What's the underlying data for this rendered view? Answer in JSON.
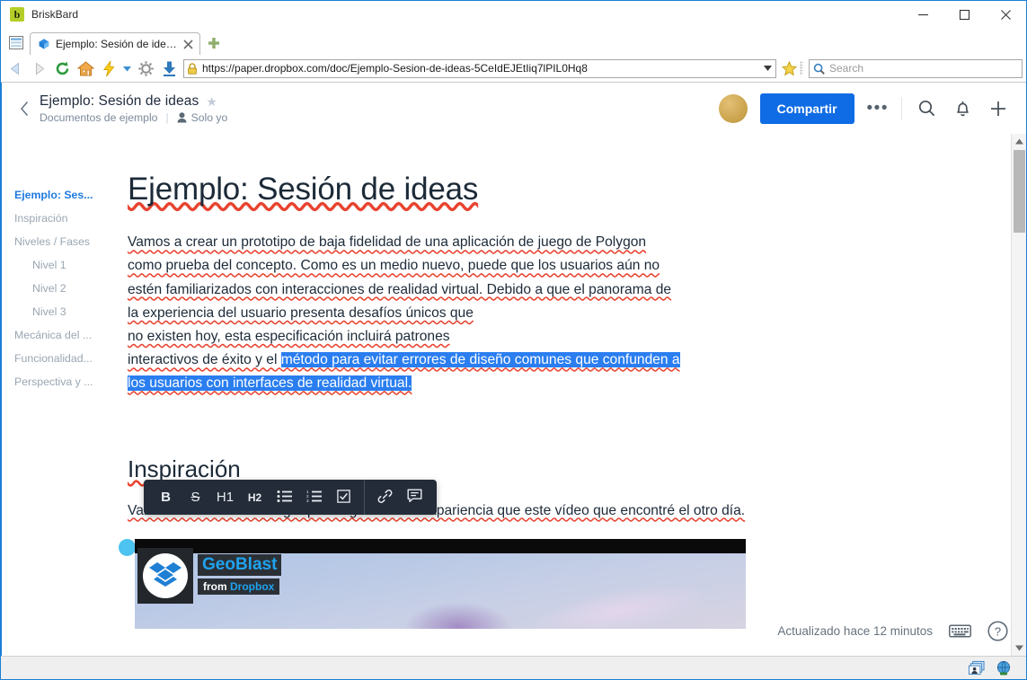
{
  "window": {
    "app_title": "BriskBard",
    "app_logo_letter": "b",
    "minimize_label": "Minimize",
    "maximize_label": "Maximize",
    "close_label": "Close"
  },
  "tabs": {
    "sidebar_toggle_name": "panel-toggle",
    "items": [
      {
        "label": "Ejemplo: Sesión de ideas –",
        "close_label": "✖",
        "active": true
      }
    ],
    "new_tab_label": "+"
  },
  "navbar": {
    "back_label": "Back",
    "forward_label": "Forward",
    "reload_label": "Reload",
    "home_label": "Home",
    "speed_label": "Turbo",
    "speed_dropdown_label": "▾",
    "settings_label": "Settings",
    "downloads_label": "Downloads",
    "url": "https://paper.dropbox.com/doc/Ejemplo-Sesion-de-ideas-5CeIdEJEtIiq7lPIL0Hq8",
    "url_dropdown_label": "▾",
    "bookmark_label": "Bookmark",
    "search_placeholder": "Search",
    "search_value": ""
  },
  "paper_header": {
    "back_chevron": "‹",
    "doc_title": "Ejemplo: Sesión de ideas",
    "star_label": "★",
    "folder": "Documentos de ejemplo",
    "separator": "|",
    "privacy": "Solo yo",
    "share_button": "Compartir",
    "more_button": "•••",
    "search_icon_label": "Search",
    "notifications_icon_label": "Notifications",
    "add_icon_label": "New"
  },
  "toc": {
    "items": [
      {
        "label": "Ejemplo: Ses...",
        "active": true,
        "nested": false
      },
      {
        "label": "Inspiración",
        "active": false,
        "nested": false
      },
      {
        "label": "Niveles / Fases",
        "active": false,
        "nested": false
      },
      {
        "label": "Nivel 1",
        "active": false,
        "nested": true
      },
      {
        "label": "Nivel 2",
        "active": false,
        "nested": true
      },
      {
        "label": "Nivel 3",
        "active": false,
        "nested": true
      },
      {
        "label": "Mecánica del ...",
        "active": false,
        "nested": false
      },
      {
        "label": "Funcionalidad...",
        "active": false,
        "nested": false
      },
      {
        "label": "Perspectiva y ...",
        "active": false,
        "nested": false
      }
    ]
  },
  "document": {
    "h1": "Ejemplo: Sesión de ideas",
    "paragraph1_plain": "Vamos a crear un prototipo de baja fidelidad de una aplicación de juego de Polygon como prueba del concepto. Como es un medio nuevo, puede que los usuarios aún no estén familiarizados con interacciones de realidad virtual. Debido a que el panorama de la experiencia del usuario presenta desafíos únicos que no existen hoy, esta especificación incluirá patrones interactivos de éxito y el ",
    "paragraph1_lines": [
      "Vamos a crear un prototipo de baja fidelidad de una aplicación de juego de Polygon",
      "como prueba del concepto. Como es un medio nuevo, puede que los usuarios aún no",
      "estén familiarizados con interacciones de realidad virtual. Debido a que el panorama de",
      "la experiencia del usuario presenta desafíos únicos que",
      "no existen hoy, esta especificación incluirá patrones",
      "interactivos de éxito y el "
    ],
    "selected_text_line1": "método para evitar errores de diseño comunes que confunden a",
    "selected_text_line2": "los usuarios con interfaces de realidad virtual.",
    "h2": "Inspiración",
    "paragraph2": "Vamos a intentar crear algo que tenga la misma apariencia que este vídeo que encontré el otro día."
  },
  "format_toolbar": {
    "buttons": [
      {
        "name": "bold",
        "glyph": "B"
      },
      {
        "name": "strikethrough",
        "glyph": "S"
      },
      {
        "name": "heading-1",
        "glyph": "H1"
      },
      {
        "name": "heading-2",
        "glyph": "H2"
      },
      {
        "name": "bulleted-list",
        "glyph": "list"
      },
      {
        "name": "numbered-list",
        "glyph": "numlist"
      },
      {
        "name": "todo-list",
        "glyph": "check"
      },
      {
        "name": "link",
        "glyph": "link"
      },
      {
        "name": "comment",
        "glyph": "comment"
      }
    ]
  },
  "embed": {
    "title": "GeoBlast",
    "subtitle_prefix": "from",
    "subtitle_brand": "Dropbox"
  },
  "paper_status": {
    "updated_text": "Actualizado hace 12 minutos",
    "keyboard_icon_label": "Keyboard shortcuts",
    "help_icon_label": "Help"
  },
  "scrollbar": {
    "up_arrow": "▲",
    "down_arrow": "▼"
  },
  "status_bar": {
    "tray1_label": "windows",
    "tray2_label": "network"
  },
  "colors": {
    "accent_blue": "#0f6ce4",
    "selection_blue": "#2a7ef0",
    "toc_active": "#1f7ae0",
    "toolbar_dark": "#242c39",
    "spellcheck_red": "#e8432f",
    "frame_blue": "#1a7fd4"
  }
}
